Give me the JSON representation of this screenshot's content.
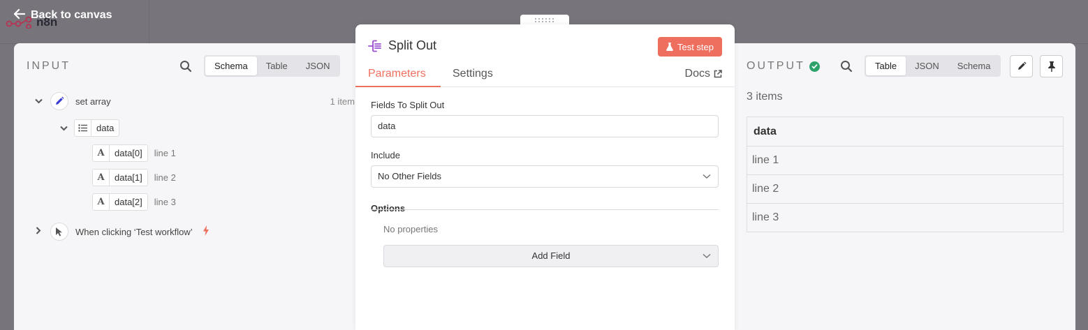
{
  "header": {
    "back_label": "Back to canvas",
    "logo_text": "n8n"
  },
  "input": {
    "title": "INPUT",
    "view_modes": [
      "Schema",
      "Table",
      "JSON"
    ],
    "active_view": "Schema",
    "nodes": [
      {
        "name": "set array",
        "item_count": "1 item",
        "fields": [
          {
            "name": "data",
            "type": "array",
            "children": [
              {
                "name": "data[0]",
                "type_glyph": "A",
                "value": "line 1"
              },
              {
                "name": "data[1]",
                "type_glyph": "A",
                "value": "line 2"
              },
              {
                "name": "data[2]",
                "type_glyph": "A",
                "value": "line 3"
              }
            ]
          }
        ]
      },
      {
        "name": "When clicking ‘Test workflow’"
      }
    ]
  },
  "node": {
    "name": "Split Out",
    "test_button": "Test step",
    "tabs": [
      "Parameters",
      "Settings"
    ],
    "active_tab": "Parameters",
    "docs_label": "Docs",
    "params": {
      "fields_to_split_label": "Fields To Split Out",
      "fields_to_split_value": "data",
      "include_label": "Include",
      "include_value": "No Other Fields",
      "options_label": "Options",
      "no_properties": "No properties",
      "add_field": "Add Field"
    }
  },
  "output": {
    "title": "OUTPUT",
    "view_modes": [
      "Table",
      "JSON",
      "Schema"
    ],
    "active_view": "Table",
    "item_count": "3 items",
    "table": {
      "headers": [
        "data"
      ],
      "rows": [
        [
          "line 1"
        ],
        [
          "line 2"
        ],
        [
          "line 3"
        ]
      ]
    }
  },
  "colors": {
    "accent": "#ef6f5e",
    "success": "#2da36b",
    "edit_icon": "#3b3bd6",
    "node_icon": "#9b4fd0"
  }
}
